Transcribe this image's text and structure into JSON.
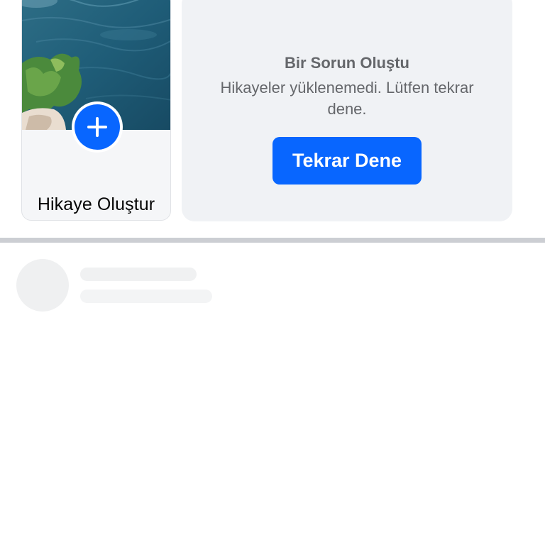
{
  "stories": {
    "create_story_label": "Hikaye Oluştur",
    "create_icon": "plus-icon"
  },
  "error": {
    "title": "Bir Sorun Oluştu",
    "message": "Hikayeler yüklenemedi. Lütfen tekrar dene.",
    "retry_label": "Tekrar Dene"
  },
  "colors": {
    "accent": "#0866ff",
    "panel_bg": "#f0f2f5",
    "muted_text": "#65676b",
    "divider": "#ccced3"
  }
}
